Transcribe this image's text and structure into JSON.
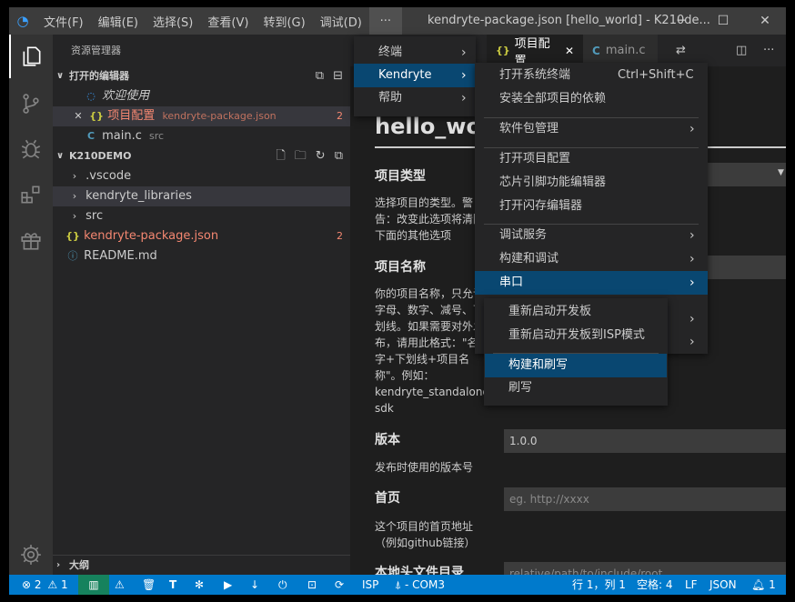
{
  "titlebar": {
    "logo_icon": "kendryte-logo-icon",
    "menus": [
      "文件(F)",
      "编辑(E)",
      "选择(S)",
      "查看(V)",
      "转到(G)",
      "调试(D)",
      "···"
    ],
    "title": "kendryte-package.json [hello_world] - K210de...",
    "minimize": "─",
    "maximize": "☐",
    "close": "✕"
  },
  "sidebar": {
    "title": "资源管理器",
    "open_editors": {
      "header": "打开的编辑器",
      "items": [
        {
          "icon": "◌",
          "name": "欢迎使用",
          "desc": "",
          "badge": ""
        },
        {
          "icon": "{}",
          "name": "项目配置",
          "desc": "kendryte-package.json",
          "badge": "2"
        },
        {
          "icon": "C",
          "name": "main.c",
          "desc": "src",
          "badge": ""
        }
      ]
    },
    "project": {
      "header": "K210DEMO",
      "items": [
        {
          "name": ".vscode",
          "badge": ""
        },
        {
          "name": "kendryte_libraries",
          "badge": ""
        },
        {
          "name": "src",
          "badge": ""
        },
        {
          "name": "kendryte-package.json",
          "badge": "2"
        },
        {
          "name": "README.md",
          "badge": ""
        }
      ]
    },
    "outline": "大纲"
  },
  "tabs": [
    {
      "icon": "{}",
      "label": "项目配置",
      "close": "✕"
    },
    {
      "icon": "C",
      "label": "main.c"
    }
  ],
  "editor": {
    "heading": "hello_world",
    "dropdown_arrow": "▼",
    "fields": [
      {
        "label": "项目类型",
        "desc": "选择项目的类型。警告：改变此选项将清除下面的其他选项",
        "value": ""
      },
      {
        "label": "项目名称",
        "desc": "你的项目名称，只允许字母、数字、减号、下划线。如果需要对外发布，请用此格式：\"名字+下划线+项目名称\"。例如：kendryte_standalone-sdk",
        "value": ""
      },
      {
        "label": "版本",
        "desc": "发布时使用的版本号",
        "value": "1.0.0"
      },
      {
        "label": "首页",
        "desc": "这个项目的首页地址（例如github链接）",
        "placeholder": "eg. http://xxxx"
      },
      {
        "label": "本地头文件目录",
        "desc": "",
        "placeholder": "relative/path/to/include/root"
      }
    ]
  },
  "menu_main": {
    "items": [
      "终端",
      "Kendryte",
      "帮助"
    ]
  },
  "menu_kendryte": {
    "items": [
      {
        "label": "打开系统终端",
        "shortcut": "Ctrl+Shift+C"
      },
      {
        "label": "安装全部项目的依赖",
        "shortcut": ""
      },
      {
        "label": "软件包管理",
        "shortcut": ""
      },
      {
        "label": "打开项目配置",
        "shortcut": ""
      },
      {
        "label": "芯片引脚功能编辑器",
        "shortcut": ""
      },
      {
        "label": "打开闪存编辑器",
        "shortcut": ""
      },
      {
        "label": "调试服务",
        "shortcut": ""
      },
      {
        "label": "构建和调试",
        "shortcut": ""
      },
      {
        "label": "串口",
        "shortcut": ""
      }
    ]
  },
  "menu_serial": {
    "items": [
      "重新启动开发板",
      "重新启动开发板到ISP模式",
      "构建和刷写",
      "刷写"
    ]
  },
  "statusbar": {
    "errors": "2",
    "warnings": "1",
    "isp": "ISP",
    "port": "- COM3",
    "position": "行 1，列 1",
    "indent": "空格: 4",
    "eol": "LF",
    "language": "JSON",
    "notifications": "1"
  },
  "colors": {
    "accent": "#007acc",
    "highlight": "#094771",
    "modified": "#f48771",
    "json_icon": "#cbcb41",
    "c_icon": "#519aba"
  }
}
